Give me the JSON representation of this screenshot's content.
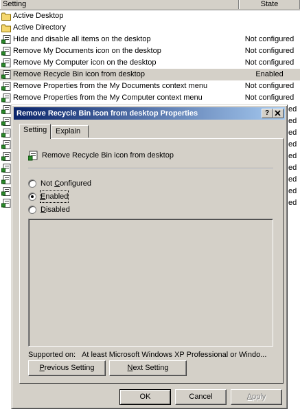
{
  "listview": {
    "columns": {
      "setting": "Setting",
      "state": "State"
    },
    "rows": [
      {
        "name": "Active Desktop",
        "state": "",
        "icon": "folder-icon"
      },
      {
        "name": "Active Directory",
        "state": "",
        "icon": "folder-icon"
      },
      {
        "name": "Hide and disable all items on the desktop",
        "state": "Not configured",
        "icon": "policy-icon"
      },
      {
        "name": "Remove My Documents icon on the desktop",
        "state": "Not configured",
        "icon": "policy-icon"
      },
      {
        "name": "Remove My Computer icon on the desktop",
        "state": "Not configured",
        "icon": "policy-icon"
      },
      {
        "name": "Remove Recycle Bin icon from desktop",
        "state": "Enabled",
        "icon": "policy-icon",
        "selected": true
      },
      {
        "name": "Remove Properties from the My Documents context menu",
        "state": "Not configured",
        "icon": "policy-icon"
      },
      {
        "name": "Remove Properties from the My Computer context menu",
        "state": "Not configured",
        "icon": "policy-icon"
      }
    ],
    "hidden_row_state_fragment": "ed"
  },
  "dialog": {
    "title": "Remove Recycle Bin icon from desktop Properties",
    "help_button": "?",
    "close_button": "X",
    "tabs": [
      {
        "label": "Setting",
        "active": true
      },
      {
        "label": "Explain",
        "active": false
      }
    ],
    "policy_name": "Remove Recycle Bin icon from desktop",
    "options": [
      {
        "label": "Not Configured",
        "checked": false
      },
      {
        "label": "Enabled",
        "checked": true
      },
      {
        "label": "Disabled",
        "checked": false
      }
    ],
    "supported_label": "Supported on:",
    "supported_value": "At least Microsoft Windows XP Professional or Windo...",
    "buttons": {
      "previous": "Previous Setting",
      "next": "Next Setting",
      "ok": "OK",
      "cancel": "Cancel",
      "apply": "Apply"
    }
  },
  "colors": {
    "face": "#d4d0c8",
    "title_start": "#0a246a",
    "title_end": "#a6caf0"
  }
}
